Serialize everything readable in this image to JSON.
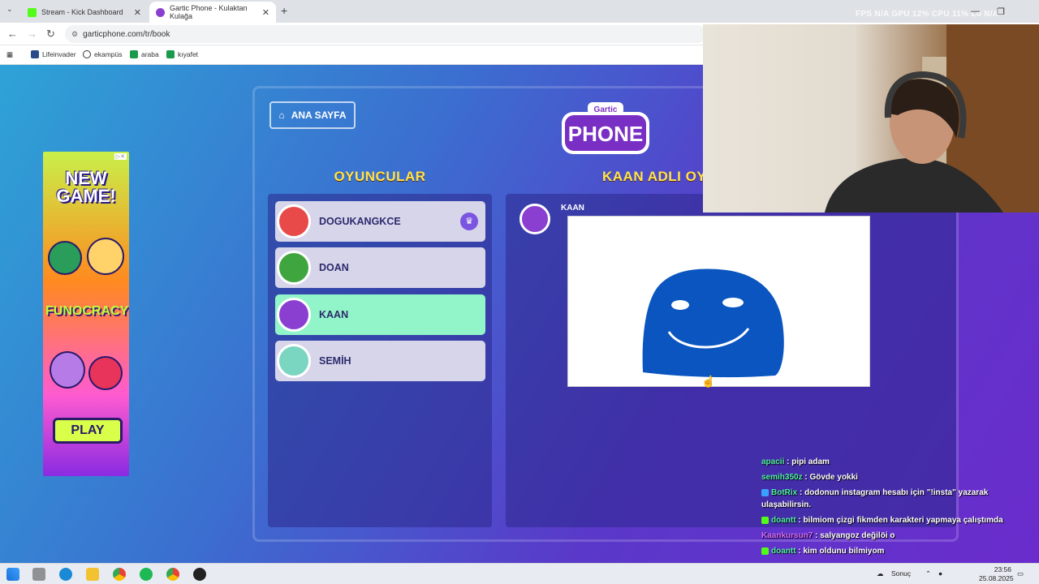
{
  "browser": {
    "tabs": [
      {
        "title": "Stream - Kick Dashboard",
        "color": "#53fc18"
      },
      {
        "title": "Gartic Phone - Kulaktan Kulağa",
        "color": "#8a3fd1"
      }
    ],
    "url": "garticphone.com/tr/book",
    "bookmarks": [
      "Lifeinvader",
      "ekampüs",
      "araba",
      "kıyafet"
    ],
    "stats": "FPS N/A   GPU 12%   CPU 11%   Lo N/A"
  },
  "ad": {
    "headline": "NEW GAME!",
    "brand": "FUNOCRACY",
    "button": "PLAY"
  },
  "game": {
    "home_label": "ANA SAYFA",
    "logo_top": "Gartic",
    "logo_main": "PHONE",
    "players_heading": "OYUNCULAR",
    "book_heading": "KAAN ADLI OYUNCUNUN ALBÜMÜ",
    "players": [
      {
        "name": "DOGUKANGKCE",
        "host": true,
        "highlight": false,
        "avatar_color": "#e84a4a"
      },
      {
        "name": "DOAN",
        "host": false,
        "highlight": false,
        "avatar_color": "#3fa63f"
      },
      {
        "name": "KAAN",
        "host": false,
        "highlight": true,
        "avatar_color": "#8a3fd1"
      },
      {
        "name": "SEMİH",
        "host": false,
        "highlight": false,
        "avatar_color": "#7ad6c0"
      }
    ],
    "book_entry_author": "KAAN",
    "drawing_color": "#0a55c0"
  },
  "chat": [
    {
      "user": "apacii",
      "text": "pipi adam",
      "color": "#4ef0a0",
      "badge": ""
    },
    {
      "user": "semih350z",
      "text": "Gövde yokki",
      "color": "#4ef0a0",
      "badge": ""
    },
    {
      "user": "BotRix",
      "text": "dodonun instagram hesabı için \"!insta\" yazarak ulaşabilirsin.",
      "color": "#4ef0a0",
      "badge": "#3aa0ff"
    },
    {
      "user": "doantt",
      "text": "bilmiom çizgi fikmden karakteri yapmaya çalıştımda",
      "color": "#4ef0a0",
      "badge": "#53fc18"
    },
    {
      "user": "Kaankursun7",
      "text": "salyangoz değilöi o",
      "color": "#d66bff",
      "badge": ""
    },
    {
      "user": "doantt",
      "text": "kim oldunu bilmiyom",
      "color": "#4ef0a0",
      "badge": "#53fc18"
    }
  ],
  "taskbar": {
    "search_label": "Sonuç",
    "time": "23:56",
    "date": "25.08.2025"
  }
}
